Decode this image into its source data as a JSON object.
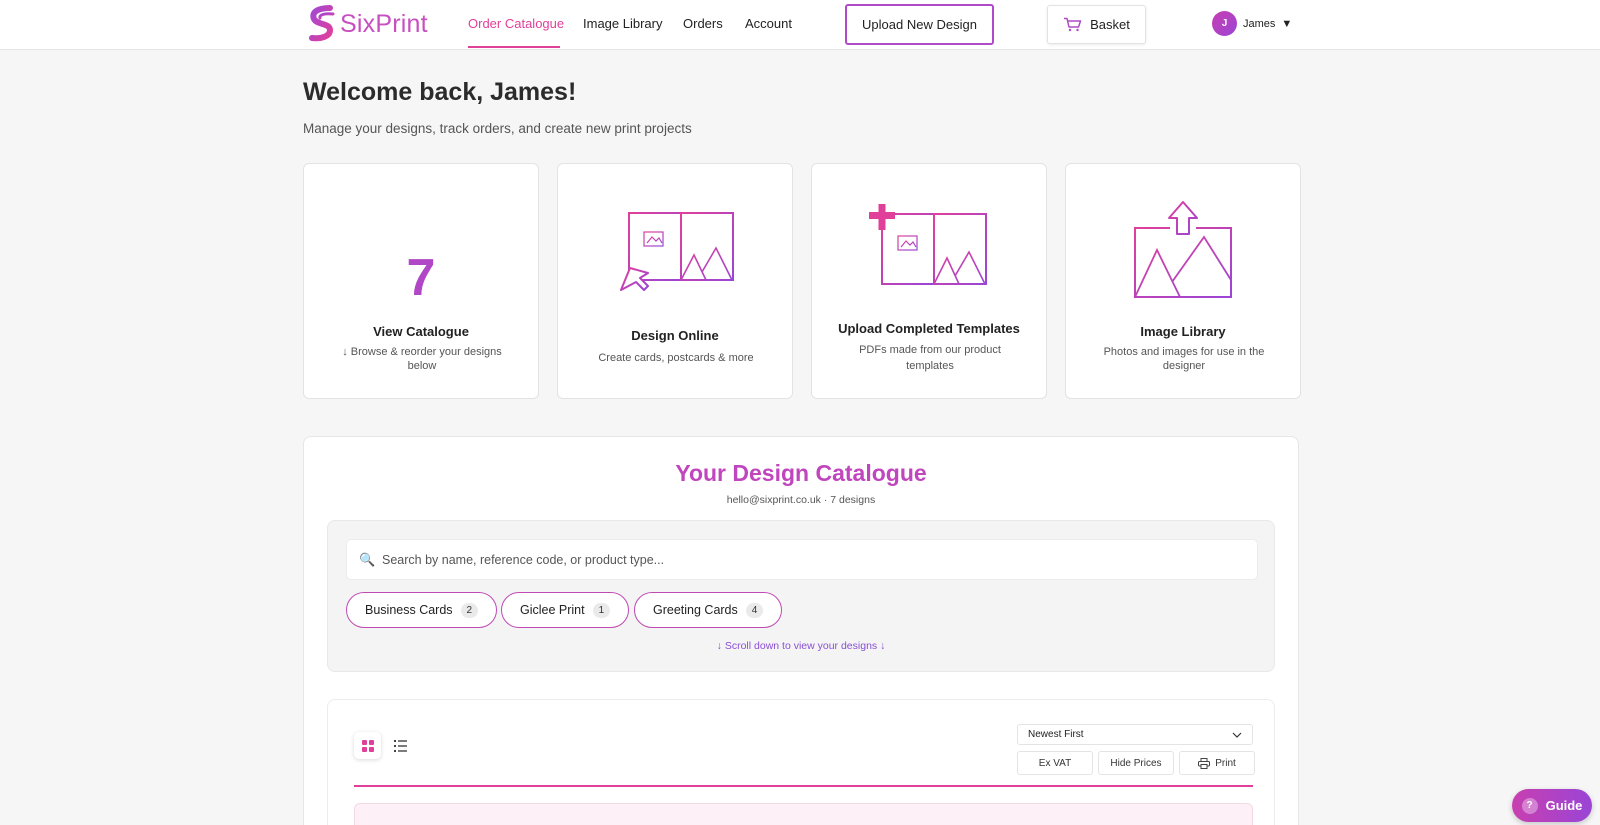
{
  "nav": {
    "brand": "SixPrint",
    "links": [
      {
        "label": "Order Catalogue",
        "active": true
      },
      {
        "label": "Image Library"
      },
      {
        "label": "Orders"
      },
      {
        "label": "Account"
      }
    ],
    "upload_label": "Upload New Design",
    "basket_label": "Basket",
    "user_initial": "J",
    "user_name": "James",
    "user_caret": "▼"
  },
  "header": {
    "title": "Welcome back, James!",
    "subtitle": "Manage your designs, track orders, and create new print projects"
  },
  "cards": [
    {
      "number": "7",
      "title": "View Catalogue",
      "desc": "↓ Browse & reorder your designs below"
    },
    {
      "title": "Design Online",
      "desc": "Create cards, postcards & more"
    },
    {
      "title": "Upload Completed Templates",
      "desc": "PDFs made from our product templates"
    },
    {
      "title": "Image Library",
      "desc": "Photos and images for use in the designer"
    }
  ],
  "catalogue": {
    "title": "Your Design Catalogue",
    "subtitle": "hello@sixprint.co.uk · 7 designs",
    "search_placeholder": "Search by name, reference code, or product type...",
    "chips": [
      {
        "label": "Business Cards",
        "count": "2"
      },
      {
        "label": "Giclee Print",
        "count": "1"
      },
      {
        "label": "Greeting Cards",
        "count": "4"
      }
    ],
    "scroll_hint": "↓  Scroll down to view your designs ↓",
    "sort_value": "Newest First",
    "ex_vat": "Ex VAT",
    "hide_prices": "Hide Prices",
    "print": "Print"
  },
  "guide_label": "Guide",
  "colors": {
    "accent_pink": "#e0409a",
    "accent_purple": "#9a45d6",
    "brand": "#c84fc0"
  }
}
